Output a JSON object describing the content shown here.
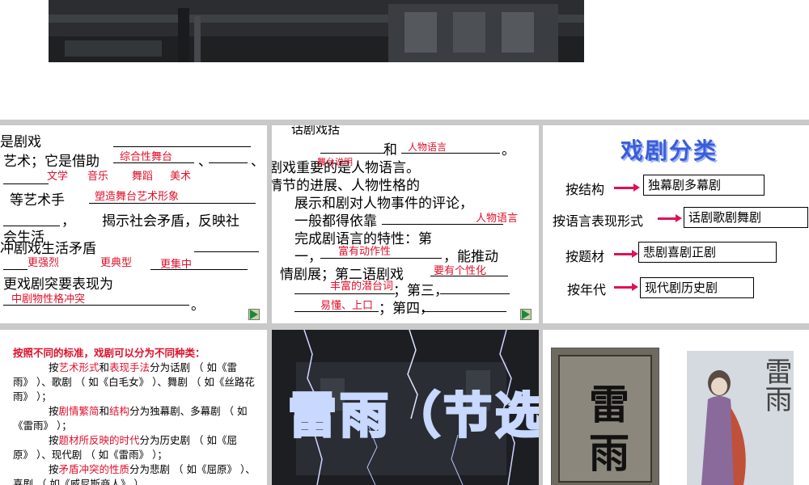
{
  "slide1": {
    "l1": "是剧戏",
    "l2": "艺术；它是借助",
    "l2_a1": "综合性舞台",
    "l2_mid": "、",
    "l2_end": "、",
    "l3_a1": "文学",
    "l3_a2": "音乐",
    "l3_a3": "舞蹈",
    "l3_a4": "美术",
    "l4": "等艺术手",
    "l4_a": "塑造舞台艺术形象",
    "l5": "揭示社会矛盾，反映社",
    "l6": "会生活",
    "l7": "冲剧戏生活矛盾",
    "l8_a1": "更强烈",
    "l8_a2": "更典型",
    "l8_a3": "更集中",
    "l9": "更戏剧突要表现为",
    "l10_a": "中剧物性格冲突",
    "period": "。"
  },
  "slide2": {
    "l0": "话剧戏括",
    "l1": "和",
    "l1_a": "人物语言",
    "period": "。",
    "l2": "剧戏重要的是人物语言。",
    "l2_a": "舞台说明",
    "l3": "情节的进展、人物性格的",
    "l4": "展示和剧对人物事件的评论，",
    "l5": "一般都得依靠",
    "l5_a": "人物语言",
    "l6": "完成剧语言的特性：第",
    "l7": "一，",
    "l7_a": "富有动作性",
    "l7_end": "，能推动",
    "l8": "情剧展；第二语剧戏",
    "l8_a": "要有个性化",
    "l9_a": "丰富的潜台词",
    "l9_end": "；第三，",
    "l10_a": "易懂、上口",
    "l10_end": "；第四，"
  },
  "slide3": {
    "title": "戏剧分类",
    "rows": [
      {
        "label": "按结构",
        "value": "独幕剧多幕剧"
      },
      {
        "label": "按语言表现形式",
        "value": "话剧歌剧舞剧"
      },
      {
        "label": "按题材",
        "value": "悲剧喜剧正剧"
      },
      {
        "label": "按年代",
        "value": "现代剧历史剧"
      }
    ]
  },
  "slide4": {
    "heading": "按照不同的标准，戏剧可以分为不同种类：",
    "p1_a": "按",
    "p1_b": "艺术形式",
    "p1_c": "和",
    "p1_d": "表现手法",
    "p1_e": "分为话剧 （ 如《雷雨》 ）、歌剧 （ 如《白毛女》 ）、舞剧 （ 如《丝路花雨》 ）；",
    "p2_a": "按",
    "p2_b": "剧情繁简",
    "p2_c": "和",
    "p2_d": "结构",
    "p2_e": "分为独幕剧、多幕剧 （ 如《雷雨》 ）；",
    "p3_a": "按",
    "p3_b": "题材所反映的时代",
    "p3_e": "分为历史剧 （ 如《屈原》 ）、现代剧 （ 如《雷雨》 ）；",
    "p4_a": "按",
    "p4_b": "矛盾冲突的性质",
    "p4_e": "分为悲剧 （ 如《屈原》 ）、喜剧 （ 如《威尼斯商人》 ）、"
  },
  "slide5": {
    "title": "雷雨（节选）"
  },
  "slide6": {
    "book_title": "雷雨",
    "poster_title": "雷雨"
  },
  "colors": {
    "accent_red": "#e0102a",
    "title_blue": "#3a5dd8",
    "arrow_pink": "#e0105a"
  }
}
